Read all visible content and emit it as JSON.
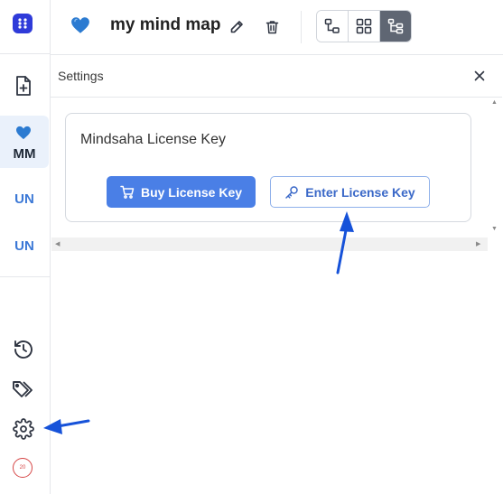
{
  "header": {
    "title": "my mind map",
    "view_modes": [
      "map-view",
      "grid-view",
      "tree-view"
    ],
    "active_view": "tree-view"
  },
  "sidebar": {
    "maps": [
      {
        "label": "MM",
        "selected": true
      },
      {
        "label": "UN",
        "selected": false
      },
      {
        "label": "UN",
        "selected": false
      }
    ],
    "badge": "20"
  },
  "settings": {
    "title": "Settings",
    "license_heading": "Mindsaha License Key",
    "buy_label": "Buy License Key",
    "enter_label": "Enter License Key"
  },
  "colors": {
    "brand": "#2f3bd9",
    "primary_button": "#4a7fe6",
    "outline_button": "#3b69c8",
    "annotation_arrow": "#1652d9"
  }
}
